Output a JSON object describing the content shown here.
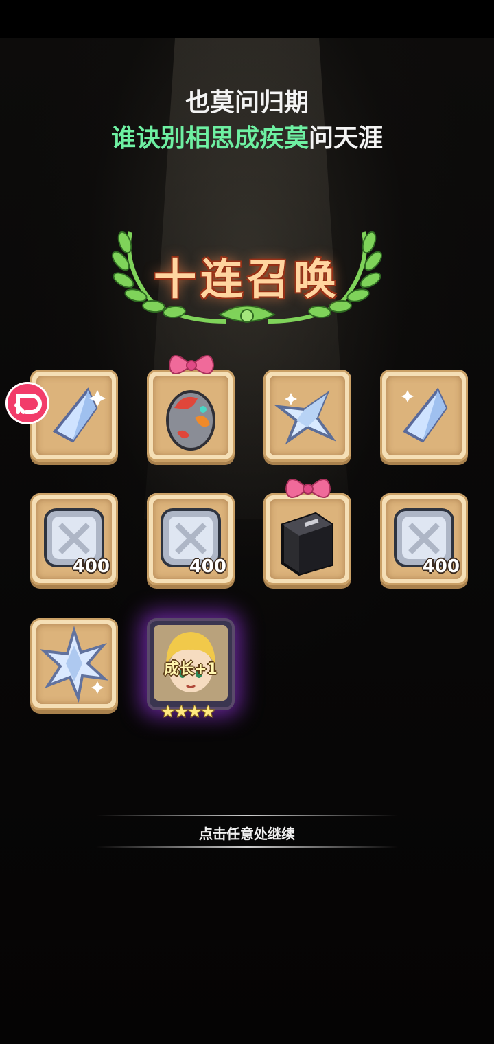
{
  "lyrics": {
    "line1": "也莫问归期",
    "line2_highlight": "谁诀别相思成疾莫",
    "line2_rest": "问天涯"
  },
  "banner": {
    "title": "十连召唤"
  },
  "rewards": [
    {
      "icon": "diamond-crystal-icon",
      "qty": "",
      "gift_bow": false
    },
    {
      "icon": "pet-egg-icon",
      "qty": "",
      "gift_bow": true
    },
    {
      "icon": "star-crystal-icon",
      "qty": "",
      "gift_bow": false
    },
    {
      "icon": "diamond-crystal-icon",
      "qty": "",
      "gift_bow": false
    },
    {
      "icon": "silver-tile-icon",
      "qty": "400",
      "gift_bow": false
    },
    {
      "icon": "silver-tile-icon",
      "qty": "400",
      "gift_bow": false
    },
    {
      "icon": "black-book-icon",
      "qty": "",
      "gift_bow": true
    },
    {
      "icon": "silver-tile-icon",
      "qty": "400",
      "gift_bow": false
    },
    {
      "icon": "spiky-crystal-icon",
      "qty": "",
      "gift_bow": false
    }
  ],
  "hero_reward": {
    "label": "成长+1",
    "stars": 4,
    "stars_text": "★★★★"
  },
  "continue": {
    "text": "点击任意处继续"
  },
  "share_badge": {
    "icon": "share-logo-icon"
  }
}
